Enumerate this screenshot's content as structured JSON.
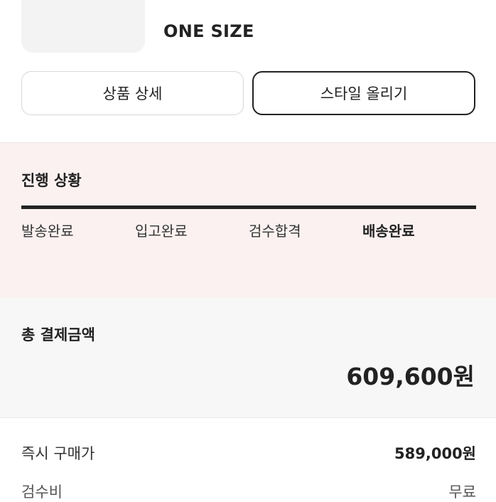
{
  "product": {
    "size": "ONE SIZE"
  },
  "actions": {
    "detail_label": "상품 상세",
    "style_label": "스타일 올리기"
  },
  "progress": {
    "title": "진행 상황",
    "steps": [
      {
        "label": "발송완료",
        "active": false
      },
      {
        "label": "입고완료",
        "active": false
      },
      {
        "label": "검수합격",
        "active": false
      },
      {
        "label": "배송완료",
        "active": true
      }
    ],
    "fraction_complete": 1.0
  },
  "payment": {
    "title": "총 결제금액",
    "total": "609,600원",
    "rows": [
      {
        "label": "즉시 구매가",
        "value": "589,000원"
      },
      {
        "label": "검수비",
        "value": "무료"
      }
    ]
  },
  "colors": {
    "accent": "#222222",
    "progress_bg": "#fbf1f1",
    "product_green": "#27a83a"
  }
}
